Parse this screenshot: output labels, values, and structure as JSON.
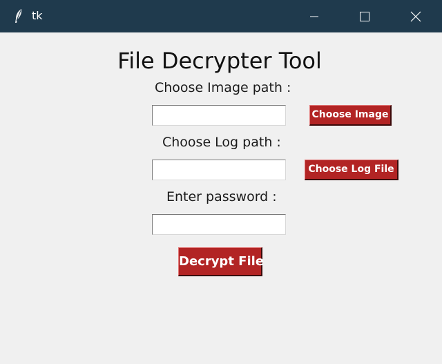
{
  "window": {
    "title": "tk",
    "titlebar_color": "#1f3a4d",
    "app_icon": "feather-icon",
    "controls": {
      "minimize_icon": "minimize-icon",
      "maximize_icon": "maximize-icon",
      "close_icon": "close-icon"
    }
  },
  "form": {
    "heading": "File Decrypter Tool",
    "image_path_label": "Choose Image path :",
    "image_path_value": "",
    "choose_image_button": "Choose Image",
    "log_path_label": "Choose Log path :",
    "log_path_value": "",
    "choose_log_button": "Choose Log File",
    "password_label": "Enter password :",
    "password_value": "",
    "decrypt_button": "Decrypt File",
    "button_color": "#b22424"
  }
}
